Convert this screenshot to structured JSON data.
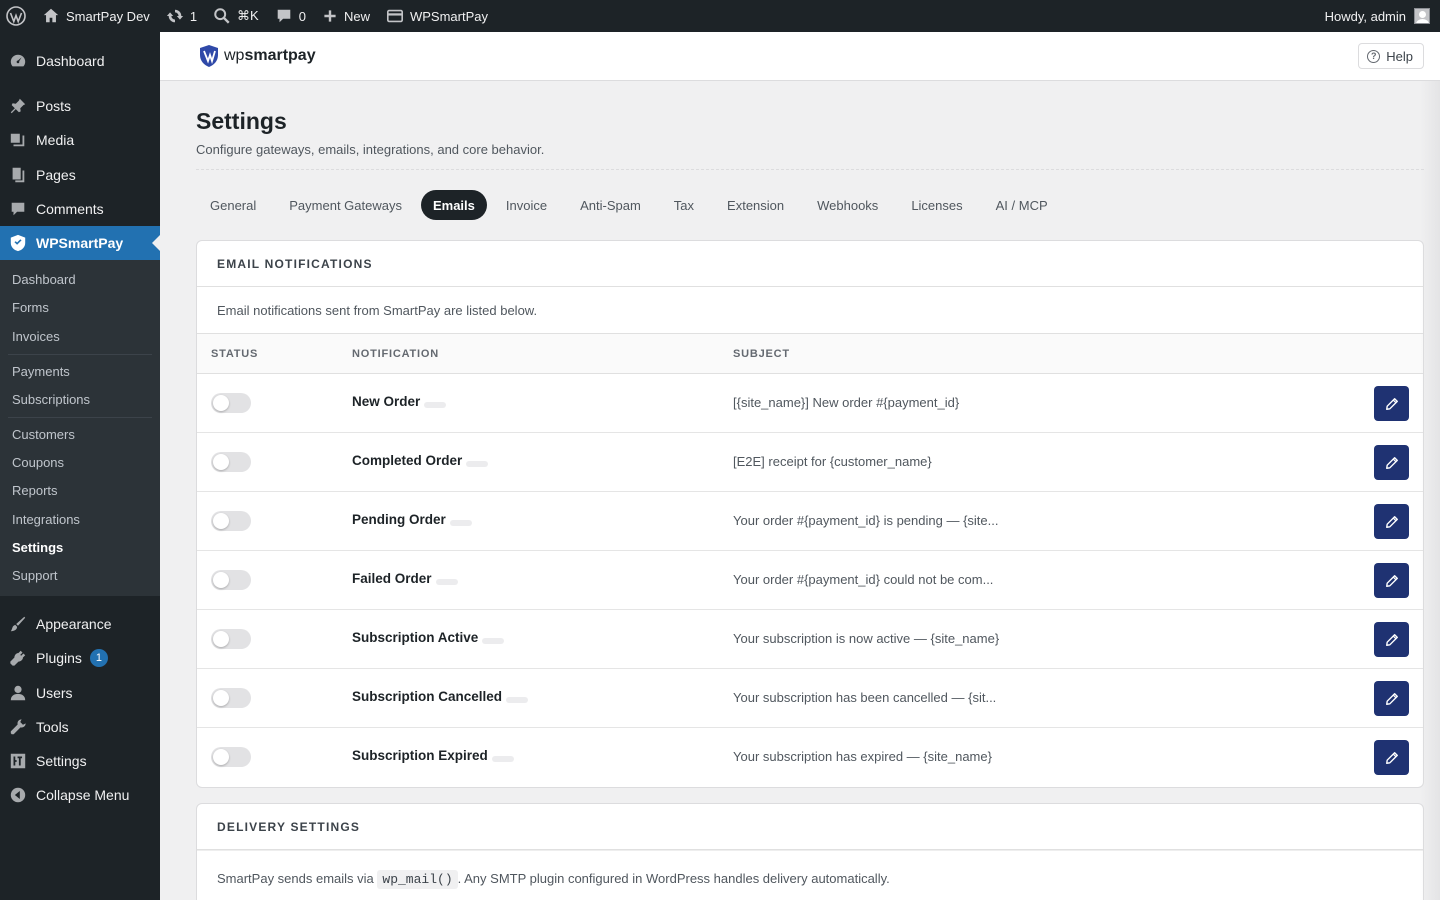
{
  "adminbar": {
    "site_name": "SmartPay Dev",
    "updates_count": "1",
    "search_shortcut": "⌘K",
    "comments_count": "0",
    "new_label": "New",
    "plugin_label": "WPSmartPay",
    "howdy": "Howdy, admin"
  },
  "sidebar": {
    "dashboard": "Dashboard",
    "posts": "Posts",
    "media": "Media",
    "pages": "Pages",
    "comments": "Comments",
    "wpsmartpay": "WPSmartPay",
    "appearance": "Appearance",
    "plugins": "Plugins",
    "plugins_badge": "1",
    "users": "Users",
    "tools": "Tools",
    "settings": "Settings",
    "collapse": "Collapse Menu",
    "submenu": [
      "Dashboard",
      "Forms",
      "Invoices",
      "Payments",
      "Subscriptions",
      "Customers",
      "Coupons",
      "Reports",
      "Integrations",
      "Settings",
      "Support"
    ]
  },
  "header": {
    "brand_wp": "wp",
    "brand_sp": "smartpay",
    "help": "Help"
  },
  "page": {
    "title": "Settings",
    "description": "Configure gateways, emails, integrations, and core behavior."
  },
  "tabs": [
    "General",
    "Payment Gateways",
    "Emails",
    "Invoice",
    "Anti-Spam",
    "Tax",
    "Extension",
    "Webhooks",
    "Licenses",
    "AI / MCP"
  ],
  "active_tab": "Emails",
  "email_notifications": {
    "heading": "EMAIL NOTIFICATIONS",
    "description": "Email notifications sent from SmartPay are listed below.",
    "columns": {
      "status": "STATUS",
      "notification": "NOTIFICATION",
      "subject": "SUBJECT"
    },
    "rows": [
      {
        "name": "New Order",
        "subject": "[{site_name}] New order #{payment_id}",
        "enabled": false
      },
      {
        "name": "Completed Order",
        "subject": "[E2E] receipt for {customer_name}",
        "enabled": false
      },
      {
        "name": "Pending Order",
        "subject": "Your order #{payment_id} is pending — {site...",
        "enabled": false
      },
      {
        "name": "Failed Order",
        "subject": "Your order #{payment_id} could not be com...",
        "enabled": false
      },
      {
        "name": "Subscription Active",
        "subject": "Your subscription is now active — {site_name}",
        "enabled": false
      },
      {
        "name": "Subscription Cancelled",
        "subject": "Your subscription has been cancelled — {sit...",
        "enabled": false
      },
      {
        "name": "Subscription Expired",
        "subject": "Your subscription has expired — {site_name}",
        "enabled": false
      }
    ]
  },
  "delivery": {
    "heading": "DELIVERY SETTINGS",
    "text_before": "SmartPay sends emails via",
    "code": "wp_mail()",
    "text_after": ". Any SMTP plugin configured in WordPress handles delivery automatically."
  },
  "colors": {
    "accent": "#2271b1",
    "edit_button": "#1f3272",
    "admin_dark": "#1d2327"
  }
}
